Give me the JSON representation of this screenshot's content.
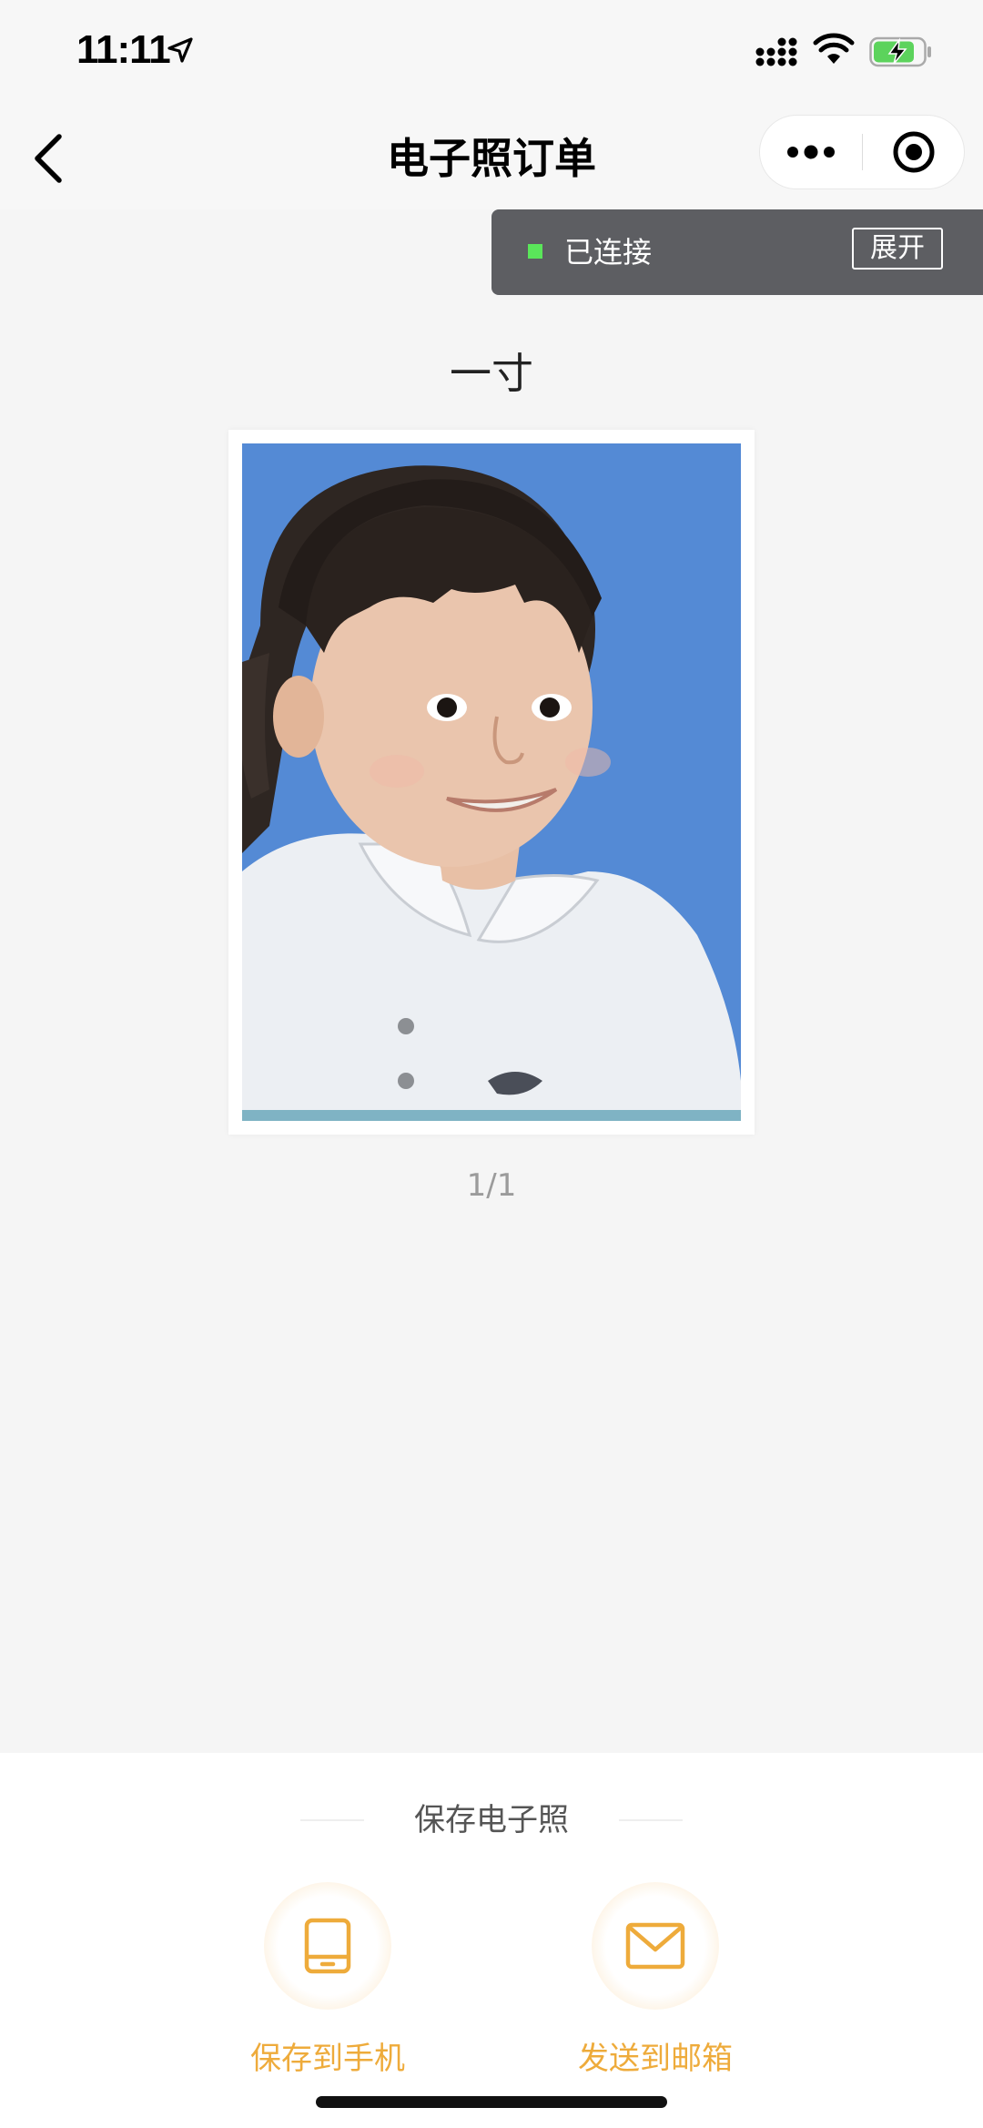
{
  "status_bar": {
    "time": "11:11",
    "icons": [
      "location-arrow-icon",
      "cellular-signal-icon",
      "wifi-icon",
      "battery-charging-icon"
    ]
  },
  "nav": {
    "title": "电子照订单",
    "back_icon": "chevron-left-icon",
    "capsule_icons": [
      "more-icon",
      "close-target-icon"
    ]
  },
  "debug": {
    "status": "已连接",
    "expand_label": "展开",
    "dot_color": "#5ae65a"
  },
  "photo": {
    "size_label": "一寸",
    "background_color": "#548ad5",
    "page_indicator": "1/1"
  },
  "save_section": {
    "title": "保存电子照",
    "actions": [
      {
        "label": "保存到手机",
        "icon": "phone-icon"
      },
      {
        "label": "发送到邮箱",
        "icon": "mail-icon"
      }
    ],
    "accent_color": "#eeab3b"
  }
}
